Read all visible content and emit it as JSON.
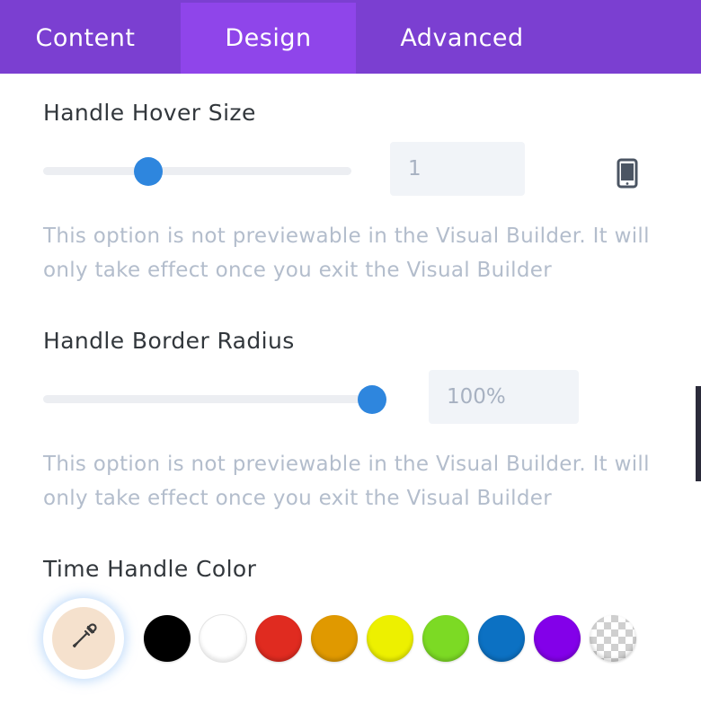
{
  "tabs": [
    {
      "label": "Content",
      "active": false
    },
    {
      "label": "Design",
      "active": true
    },
    {
      "label": "Advanced",
      "active": false
    }
  ],
  "handle_hover_size": {
    "label": "Handle Hover Size",
    "value": "1",
    "slider_fraction": 0.34,
    "responsive_icon": "phone-icon",
    "description": "This option is not previewable in the Visual Builder. It will only take effect once you exit the Visual Builder"
  },
  "handle_border_radius": {
    "label": "Handle Border Radius",
    "value": "100%",
    "slider_fraction": 1.0,
    "description": "This option is not previewable in the Visual Builder. It will only take effect once you exit the Visual Builder"
  },
  "time_handle_color": {
    "label": "Time Handle Color",
    "picker_icon": "eyedropper-icon",
    "picker_color": "#f5e1cd",
    "swatches": [
      {
        "name": "black",
        "color": "#000000"
      },
      {
        "name": "white",
        "color": "#ffffff"
      },
      {
        "name": "red",
        "color": "#e02b20"
      },
      {
        "name": "orange",
        "color": "#e09900"
      },
      {
        "name": "yellow",
        "color": "#edf000"
      },
      {
        "name": "green",
        "color": "#7cda24"
      },
      {
        "name": "blue",
        "color": "#0c71c3"
      },
      {
        "name": "purple",
        "color": "#8300e9"
      },
      {
        "name": "transparent",
        "color": "transparent"
      }
    ]
  },
  "colors": {
    "tab_bar": "#7b3fd1",
    "tab_active": "#8f45ea",
    "slider_knob": "#2e86de"
  }
}
